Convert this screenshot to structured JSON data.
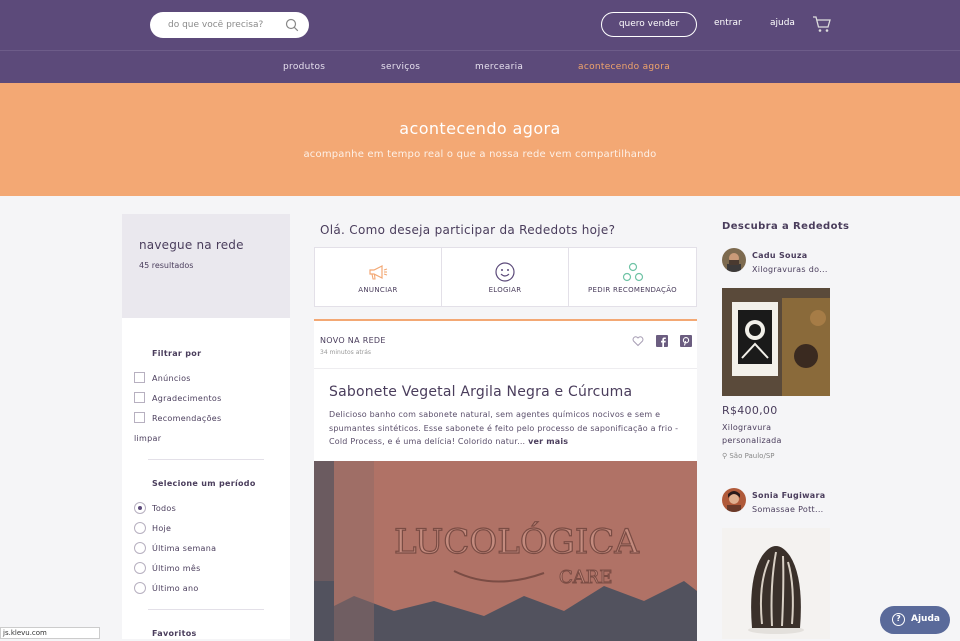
{
  "header": {
    "search_placeholder": "do que você precisa?",
    "sell_label": "quero vender",
    "login_label": "entrar",
    "help_label": "ajuda"
  },
  "nav": {
    "items": [
      {
        "label": "produtos"
      },
      {
        "label": "serviços"
      },
      {
        "label": "mercearia"
      },
      {
        "label": "acontecendo agora"
      }
    ],
    "active": "acontecendo agora"
  },
  "hero": {
    "title": "acontecendo agora",
    "subtitle": "acompanhe em tempo real o que a nossa rede vem compartilhando"
  },
  "sidebar": {
    "title": "navegue na rede",
    "results": "45 resultados",
    "filter_title": "Filtrar por",
    "filters": [
      {
        "label": "Anúncios",
        "checked": false
      },
      {
        "label": "Agradecimentos",
        "checked": false
      },
      {
        "label": "Recomendações",
        "checked": false
      }
    ],
    "clear_label": "limpar",
    "period_title": "Selecione um período",
    "periods": [
      {
        "label": "Todos",
        "selected": true
      },
      {
        "label": "Hoje",
        "selected": false
      },
      {
        "label": "Última semana",
        "selected": false
      },
      {
        "label": "Último mês",
        "selected": false
      },
      {
        "label": "Último ano",
        "selected": false
      }
    ],
    "favorites_title": "Favoritos"
  },
  "main": {
    "question": "Olá. Como deseja participar da Rededots hoje?",
    "actions": [
      {
        "label": "ANUNCIAR",
        "icon": "megaphone-icon"
      },
      {
        "label": "ELOGIAR",
        "icon": "smiley-icon"
      },
      {
        "label": "PEDIR RECOMENDAÇÃO",
        "icon": "network-icon"
      }
    ],
    "post": {
      "tag": "NOVO NA REDE",
      "time": "34 minutos atrás",
      "title": "Sabonete Vegetal Argila Negra e Cúrcuma",
      "description": "Delicioso banho com sabonete natural, sem agentes químicos nocivos e sem e spumantes sintéticos. Esse sabonete é feito pelo processo de saponificação a frio - Cold Process, e é uma delícia! Colorido natur...",
      "more_label": "ver mais",
      "stamp_text": "LUCOLÓGICA",
      "stamp_sub": "CARE"
    }
  },
  "discover": {
    "title": "Descubra a Rededots",
    "sellers": [
      {
        "name": "Cadu Souza",
        "subtitle": "Xilogravuras do..."
      },
      {
        "name": "Sonia Fugiwara",
        "subtitle": "Somassae Pott..."
      }
    ],
    "product": {
      "price": "R$400,00",
      "name": "Xilogravura personalizada",
      "location": "São Paulo/SP"
    }
  },
  "help_button": "Ajuda",
  "status_bar": "js.klevu.com",
  "colors": {
    "header_bg": "#5c4a7a",
    "hero_bg": "#f3a874",
    "accent": "#f0a46b",
    "text": "#4a3d5c"
  }
}
